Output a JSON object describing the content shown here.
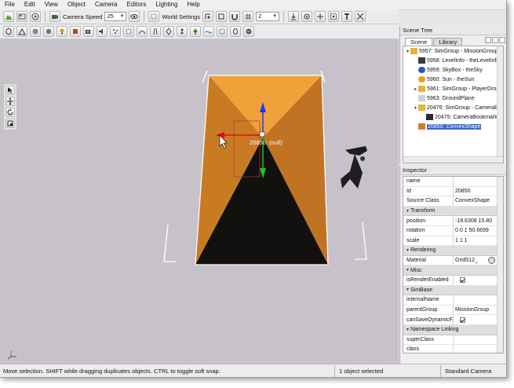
{
  "menubar": [
    "File",
    "Edit",
    "View",
    "Object",
    "Camera",
    "Editors",
    "Lighting",
    "Help"
  ],
  "toolbar": {
    "camera_speed_label": "Camera Speed",
    "camera_speed_value": "25",
    "world_settings_label": "World Settings",
    "snap_value": "2"
  },
  "viewport": {
    "object_label": "20850: (null)"
  },
  "scene_tree": {
    "title": "Scene Tree",
    "tabs": [
      "Scene",
      "Library"
    ],
    "items": [
      {
        "text": "5957: SimGroup - MissionGroup",
        "icon": "folder-open-icon",
        "expand": "▾",
        "indent": 0
      },
      {
        "text": "5958: LevelInfo - theLevelInfo",
        "icon": "level-info-icon",
        "expand": "",
        "indent": 1
      },
      {
        "text": "5959: SkyBox - theSky",
        "icon": "skybox-icon",
        "expand": "",
        "indent": 1
      },
      {
        "text": "5960: Sun - theSun",
        "icon": "sun-icon",
        "expand": "",
        "indent": 1
      },
      {
        "text": "5961: SimGroup - PlayerDropPo",
        "icon": "folder-icon",
        "expand": "▸",
        "indent": 1
      },
      {
        "text": "5963: GroundPlane",
        "icon": "ground-plane-icon",
        "expand": "",
        "indent": 1
      },
      {
        "text": "20476: SimGroup - CameraBoo",
        "icon": "folder-open-icon",
        "expand": "▾",
        "indent": 1
      },
      {
        "text": "20475: CameraBookmark [N",
        "icon": "camera-bookmark-icon",
        "expand": "",
        "indent": 2
      },
      {
        "text": "20850: ConvexShape",
        "icon": "convex-shape-icon",
        "expand": "",
        "indent": 1,
        "selected": true
      }
    ]
  },
  "inspector": {
    "title": "Inspector",
    "rows": [
      {
        "kind": "prop",
        "name": "name",
        "value": ""
      },
      {
        "kind": "prop",
        "name": "Id",
        "value": "20850"
      },
      {
        "kind": "prop",
        "name": "Source Class",
        "value": "ConvexShape"
      },
      {
        "kind": "section",
        "name": "Transform"
      },
      {
        "kind": "prop",
        "name": "position",
        "value": "-18.6308 15.80"
      },
      {
        "kind": "prop",
        "name": "rotation",
        "value": "0 0 1 50.6699"
      },
      {
        "kind": "prop",
        "name": "scale",
        "value": "1 1 1"
      },
      {
        "kind": "section",
        "name": "Rendering"
      },
      {
        "kind": "prop",
        "name": "Material",
        "value": "Grid512_"
      },
      {
        "kind": "section",
        "name": "Misc"
      },
      {
        "kind": "prop",
        "name": "isRenderEnabled",
        "value": "",
        "checkbox": true
      },
      {
        "kind": "section",
        "name": "SimBase"
      },
      {
        "kind": "prop",
        "name": "internalName",
        "value": ""
      },
      {
        "kind": "prop",
        "name": "parentGroup",
        "value": "MissionGroup"
      },
      {
        "kind": "prop",
        "name": "canSaveDynamicF...",
        "value": "",
        "checkbox": true
      },
      {
        "kind": "section",
        "name": "Namespace Linking"
      },
      {
        "kind": "prop",
        "name": "superClass",
        "value": ""
      },
      {
        "kind": "prop",
        "name": "class",
        "value": ""
      }
    ]
  },
  "status": {
    "message": "Move selection.  SHIFT while dragging duplicates objects.  CTRL to toggle soft snap.",
    "selection": "1 object selected",
    "camera": "Standard Camera"
  },
  "colors": {
    "viewport_bg": "#c7c2ca",
    "shape_orange": "#e0902e",
    "shape_dark": "#121110",
    "selection_blue": "#3366cc",
    "gizmo_red": "#e01010",
    "gizmo_green": "#18c818",
    "gizmo_blue": "#1a3cf0"
  }
}
